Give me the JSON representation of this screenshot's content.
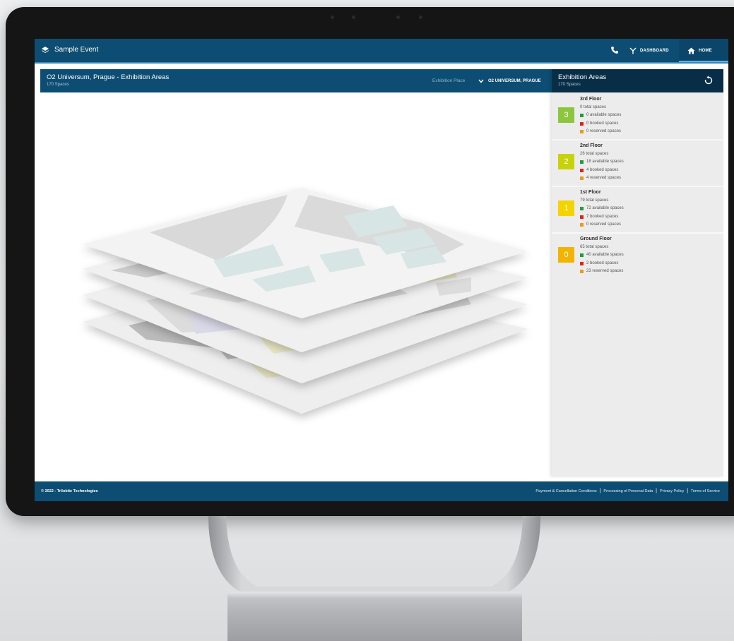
{
  "app": {
    "title": "Sample Event",
    "nav": {
      "dashboard_label": "DASHBOARD",
      "home_label": "HOME"
    },
    "icons": [
      "layers-icon",
      "phone-icon",
      "dashboard-fork-icon",
      "home-icon"
    ]
  },
  "map_panel": {
    "title": "O2 Universum, Prague - Exhibition Areas",
    "subtitle": "170 Spaces",
    "place_label": "Exhibition Place",
    "place_value": "O2 UNIVERSUM, PRAGUE"
  },
  "side_panel": {
    "title": "Exhibition Areas",
    "subtitle": "170 Spaces",
    "floors": [
      {
        "badge": "3",
        "name": "3rd Floor",
        "total": "0 total spaces",
        "available": "0 available spaces",
        "booked": "0 booked spaces",
        "reserved": "0 reserved spaces",
        "color": "#8cc63f"
      },
      {
        "badge": "2",
        "name": "2nd Floor",
        "total": "26 total spaces",
        "available": "18 available spaces",
        "booked": "4 booked spaces",
        "reserved": "4 reserved spaces",
        "color": "#c8d20a"
      },
      {
        "badge": "1",
        "name": "1st Floor",
        "total": "79 total spaces",
        "available": "72 available spaces",
        "booked": "7 booked spaces",
        "reserved": "0 reserved spaces",
        "color": "#f5d300"
      },
      {
        "badge": "0",
        "name": "Ground Floor",
        "total": "65 total spaces",
        "available": "40 available spaces",
        "booked": "2 booked spaces",
        "reserved": "23 reserved spaces",
        "color": "#f3b400"
      }
    ],
    "status_colors": {
      "available": "#1e9e3a",
      "booked": "#d9261c",
      "reserved": "#e89a1c"
    }
  },
  "footer": {
    "copyright": "© 2022 - Trilobite Technologies",
    "links": [
      "Payment & Cancellation Conditions",
      "Processing of Personal Data",
      "Privacy Policy",
      "Terms of Service"
    ]
  },
  "colors": {
    "header_blue": "#0d4d73",
    "side_header": "#082e47"
  }
}
